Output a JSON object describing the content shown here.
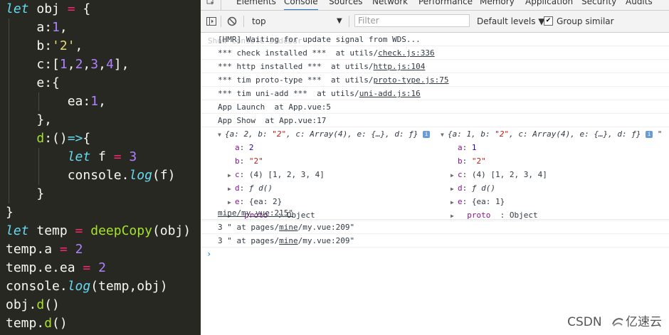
{
  "editor": {
    "lines": [
      [
        {
          "t": "let",
          "c": "kw"
        },
        {
          "t": " obj ",
          "c": "plain"
        },
        {
          "t": "=",
          "c": "op"
        },
        {
          "t": " {",
          "c": "plain"
        }
      ],
      [
        {
          "t": "    a",
          "c": "plain"
        },
        {
          "t": ":",
          "c": "plain"
        },
        {
          "t": "1",
          "c": "num"
        },
        {
          "t": ",",
          "c": "plain"
        }
      ],
      [
        {
          "t": "    b",
          "c": "plain"
        },
        {
          "t": ":",
          "c": "plain"
        },
        {
          "t": "'2'",
          "c": "str"
        },
        {
          "t": ",",
          "c": "plain"
        }
      ],
      [
        {
          "t": "    c",
          "c": "plain"
        },
        {
          "t": ":[",
          "c": "plain"
        },
        {
          "t": "1",
          "c": "num"
        },
        {
          "t": ",",
          "c": "plain"
        },
        {
          "t": "2",
          "c": "num"
        },
        {
          "t": ",",
          "c": "plain"
        },
        {
          "t": "3",
          "c": "num"
        },
        {
          "t": ",",
          "c": "plain"
        },
        {
          "t": "4",
          "c": "num"
        },
        {
          "t": "],",
          "c": "plain"
        }
      ],
      [
        {
          "t": "    e",
          "c": "plain"
        },
        {
          "t": ":{",
          "c": "plain"
        }
      ],
      [
        {
          "t": "        ea",
          "c": "plain"
        },
        {
          "t": ":",
          "c": "plain"
        },
        {
          "t": "1",
          "c": "num"
        },
        {
          "t": ",",
          "c": "plain"
        }
      ],
      [
        {
          "t": "    },",
          "c": "plain"
        }
      ],
      [
        {
          "t": "    d",
          "c": "prop"
        },
        {
          "t": ":()",
          "c": "plain"
        },
        {
          "t": "=>",
          "c": "kw"
        },
        {
          "t": "{",
          "c": "plain"
        }
      ],
      [
        {
          "t": "        ",
          "c": "plain"
        },
        {
          "t": "let",
          "c": "kw"
        },
        {
          "t": " f ",
          "c": "plain"
        },
        {
          "t": "=",
          "c": "op"
        },
        {
          "t": " ",
          "c": "plain"
        },
        {
          "t": "3",
          "c": "num"
        }
      ],
      [
        {
          "t": "        console",
          "c": "plain"
        },
        {
          "t": ".",
          "c": "plain"
        },
        {
          "t": "log",
          "c": "kw"
        },
        {
          "t": "(f)",
          "c": "plain"
        }
      ],
      [
        {
          "t": "    }",
          "c": "plain"
        }
      ],
      [
        {
          "t": "}",
          "c": "plain"
        }
      ],
      [
        {
          "t": "let",
          "c": "kw"
        },
        {
          "t": " temp ",
          "c": "plain"
        },
        {
          "t": "=",
          "c": "op"
        },
        {
          "t": " ",
          "c": "plain"
        },
        {
          "t": "deepCopy",
          "c": "fn"
        },
        {
          "t": "(obj)",
          "c": "plain"
        }
      ],
      [
        {
          "t": "temp",
          "c": "plain"
        },
        {
          "t": ".",
          "c": "plain"
        },
        {
          "t": "a ",
          "c": "plain"
        },
        {
          "t": "=",
          "c": "op"
        },
        {
          "t": " ",
          "c": "plain"
        },
        {
          "t": "2",
          "c": "num"
        }
      ],
      [
        {
          "t": "temp",
          "c": "plain"
        },
        {
          "t": ".",
          "c": "plain"
        },
        {
          "t": "e",
          "c": "plain"
        },
        {
          "t": ".",
          "c": "plain"
        },
        {
          "t": "ea ",
          "c": "plain"
        },
        {
          "t": "=",
          "c": "op"
        },
        {
          "t": " ",
          "c": "plain"
        },
        {
          "t": "2",
          "c": "num"
        }
      ],
      [
        {
          "t": "console",
          "c": "plain"
        },
        {
          "t": ".",
          "c": "plain"
        },
        {
          "t": "log",
          "c": "kw"
        },
        {
          "t": "(temp,obj)",
          "c": "plain"
        }
      ],
      [
        {
          "t": "obj",
          "c": "plain"
        },
        {
          "t": ".",
          "c": "plain"
        },
        {
          "t": "d",
          "c": "fn"
        },
        {
          "t": "()",
          "c": "plain"
        }
      ],
      [
        {
          "t": "temp",
          "c": "plain"
        },
        {
          "t": ".",
          "c": "plain"
        },
        {
          "t": "d",
          "c": "fn"
        },
        {
          "t": "()",
          "c": "plain"
        }
      ]
    ]
  },
  "devtools": {
    "tabs": [
      "Elements",
      "Console",
      "Sources",
      "Network",
      "Performance",
      "Memory",
      "Application",
      "Security",
      "Audits"
    ],
    "active_tab": "Console",
    "toolbar": {
      "context": "top",
      "filter_placeholder": "Filter",
      "levels": "Default levels ▼",
      "group_similar": "Group similar",
      "group_similar_checked": true
    },
    "ghost_text": "Show console sidebar",
    "messages": [
      {
        "text": "[HMR] Waiting for update signal from WDS...",
        "link": ""
      },
      {
        "text": "*** check installed ***  at utils/",
        "link": "check.js:336"
      },
      {
        "text": "*** http installed ***  at utils/",
        "link": "http.js:104"
      },
      {
        "text": "*** tim proto-type ***  at utils/",
        "link": "proto-type.js:75"
      },
      {
        "text": "*** tim uni-add ***  at utils/",
        "link": "uni-add.js:16"
      },
      {
        "text": "App Launch  at App.vue:5",
        "link": ""
      },
      {
        "text": "App Show  at App.vue:17",
        "link": ""
      }
    ],
    "objects": [
      {
        "summary_start": "{a: 2, b: ",
        "summary_b": "\"2\"",
        "summary_end": ", c: Array(4), e: {…}, d: ƒ}",
        "a": "2",
        "b": "\"2\"",
        "c": "(4) [1, 2, 3, 4]",
        "d": "ƒ d()",
        "e": "{ea: 2}",
        "proto": "Object"
      },
      {
        "summary_start": "{a: 1, b: ",
        "summary_b": "\"2\"",
        "summary_end": ", c: Array(4), e: {…}, d: ƒ}",
        "a": "1",
        "b": "\"2\"",
        "c": "(4) [1, 2, 3, 4]",
        "d": "ƒ d()",
        "e": "{ea: 1}",
        "proto": "Object"
      }
    ],
    "trailing_quote": "\"",
    "source_line": "mine/my.vue:215\"",
    "log_lines": [
      {
        "prefix": "3 \" at pages/",
        "link": "mine",
        "rest": "/my.vue:209\""
      },
      {
        "prefix": "3 \" at pages/",
        "link": "mine",
        "rest": "/my.vue:209\""
      }
    ],
    "prompt_symbol": "›"
  },
  "watermark": {
    "csdn": "CSDN",
    "brand": "亿速云"
  }
}
